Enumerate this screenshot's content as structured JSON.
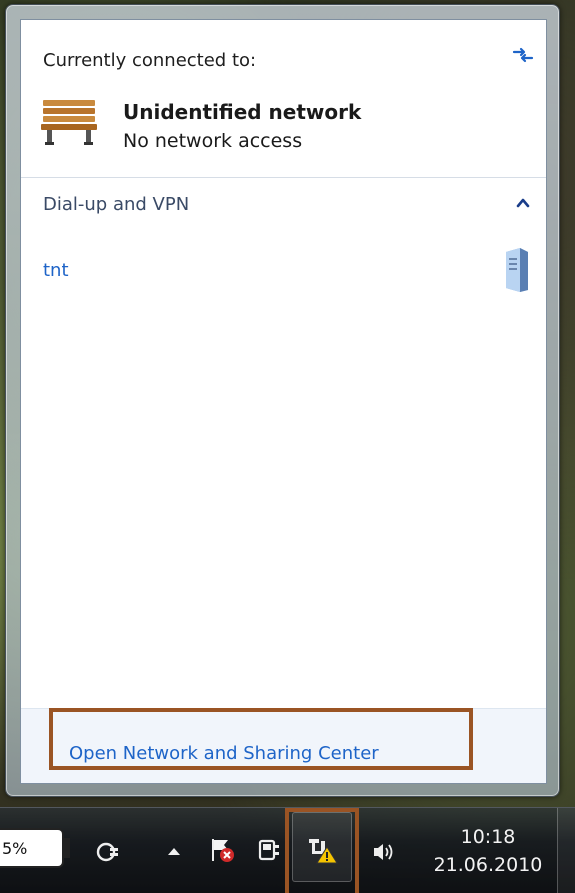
{
  "flyout": {
    "connected_title": "Currently connected to:",
    "network_name": "Unidentified network",
    "network_status": "No network access",
    "vpn_section_title": "Dial-up and VPN",
    "vpn_items": [
      {
        "label": "tnt",
        "icon": "server-icon"
      }
    ],
    "footer_link": "Open Network and Sharing Center",
    "icons": {
      "refresh": "refresh-icon",
      "network": "bench-icon",
      "collapse": "chevron-up-icon"
    }
  },
  "taskbar": {
    "battery_label": "5%",
    "clock_time": "10:18",
    "clock_date": "21.06.2010",
    "tray_icons": [
      "power-plug-icon",
      "show-hidden-icons-arrow",
      "action-center-flag-icon",
      "power-icon",
      "network-warning-icon",
      "volume-icon"
    ]
  },
  "colors": {
    "link": "#1e64c8",
    "section_header": "#3a4a66",
    "highlight": "#9a5424"
  }
}
